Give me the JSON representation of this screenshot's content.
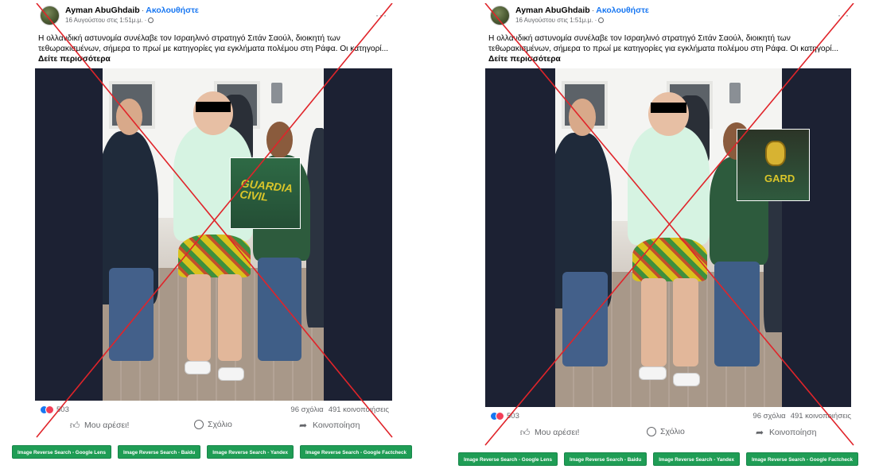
{
  "post": {
    "author": "Ayman AbuGhdaib",
    "follow_label": "Ακολουθήστε",
    "timestamp": "16 Αυγούστου στις 1:51μ.μ. ·",
    "text": "Η ολλανδική αστυνομία συνέλαβε τον Ισραηλινό στρατηγό Σιτάν Σαούλ, διοικητή των τεθωρακισμένων, σήμερα το πρωί με κατηγορίες για εγκλήματα πολέμου στη Ράφα. Οι κατηγορί...",
    "see_more": "Δείτε περισσότερα",
    "zoom_left_text": "GUARDIA CIVIL",
    "zoom_right_text": "GARD",
    "reaction_count": "503",
    "comments": "96 σχόλια",
    "shares": "491 κοινοποιήσεις",
    "like_label": "Μου αρέσει!",
    "comment_label": "Σχόλιο",
    "share_label": "Κοινοποίηση"
  },
  "search_buttons": [
    "Image Reverse Search - Google Lens",
    "Image Reverse Search - Baidu",
    "Image Reverse Search - Yandex",
    "Image Reverse Search - Google Factcheck"
  ],
  "colors": {
    "follow": "#1877f2",
    "cross": "#e0242a",
    "search_button": "#1f9d55",
    "photo_frame": "#1c2133"
  }
}
